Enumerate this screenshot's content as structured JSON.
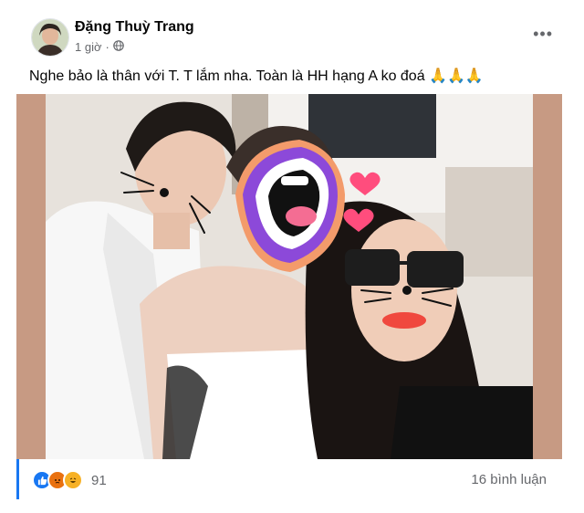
{
  "post": {
    "author": "Đặng Thuỳ Trang",
    "time": "1 giờ",
    "separator": "·",
    "privacy_icon": "globe-icon",
    "more_icon": "more-options-icon",
    "text": "Nghe bảo là thân với T. T lắm nha. Toàn là HH hạng A ko đoá 🙏🙏🙏"
  },
  "stats": {
    "reactions": [
      "like-icon",
      "angry-icon",
      "haha-icon"
    ],
    "reaction_count": "91",
    "comments": "16 bình luận"
  },
  "colors": {
    "like": "#1877f2",
    "angry": "#e9710f",
    "haha": "#f7b125",
    "photo_border": "#c79a83",
    "accent": "#1877f2"
  }
}
